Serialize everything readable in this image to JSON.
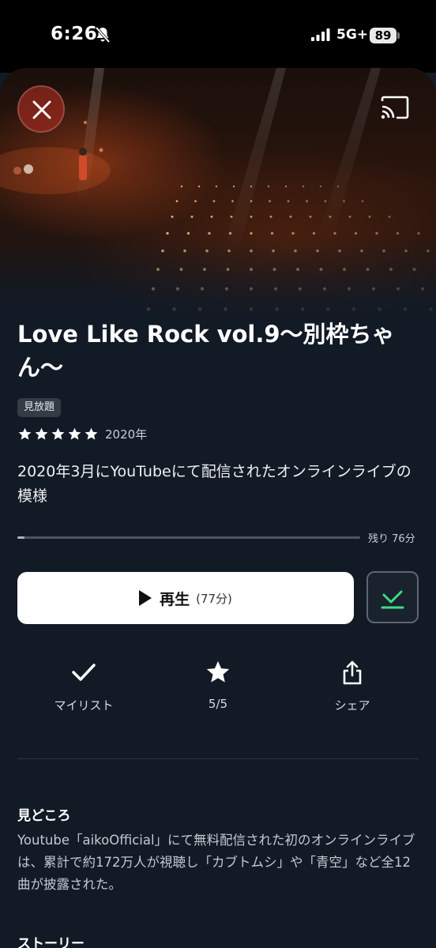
{
  "status_bar": {
    "time": "6:26",
    "network": "5G+",
    "battery": "89"
  },
  "hero": {
    "close_icon": "close-icon",
    "cast_icon": "cast-icon"
  },
  "title": "Love Like Rock vol.9〜別枠ちゃん〜",
  "badge": "見放題",
  "rating": {
    "stars": 5,
    "max": 5,
    "year": "2020年"
  },
  "description": "2020年3月にYouTubeにて配信されたオンラインライブの模様",
  "progress": {
    "watched_fraction": 0.02,
    "remaining_label": "残り 76分"
  },
  "play": {
    "label": "再生",
    "duration": "(77分)"
  },
  "download": {
    "icon": "download-done-icon",
    "accent": "#3ddc84"
  },
  "actions": [
    {
      "icon": "check-icon",
      "label": "マイリスト"
    },
    {
      "icon": "star-icon",
      "label": "5/5"
    },
    {
      "icon": "share-icon",
      "label": "シェア"
    }
  ],
  "highlights": {
    "heading": "見どころ",
    "text": "Youtube「aikoOfficial」にて無料配信された初のオンラインライブは、累計で約172万人が視聴し「カブトムシ」や「青空」など全12曲が披露された。"
  },
  "story": {
    "heading": "ストーリー"
  },
  "colors": {
    "background": "#121a26",
    "accent_green": "#3ddc84"
  }
}
